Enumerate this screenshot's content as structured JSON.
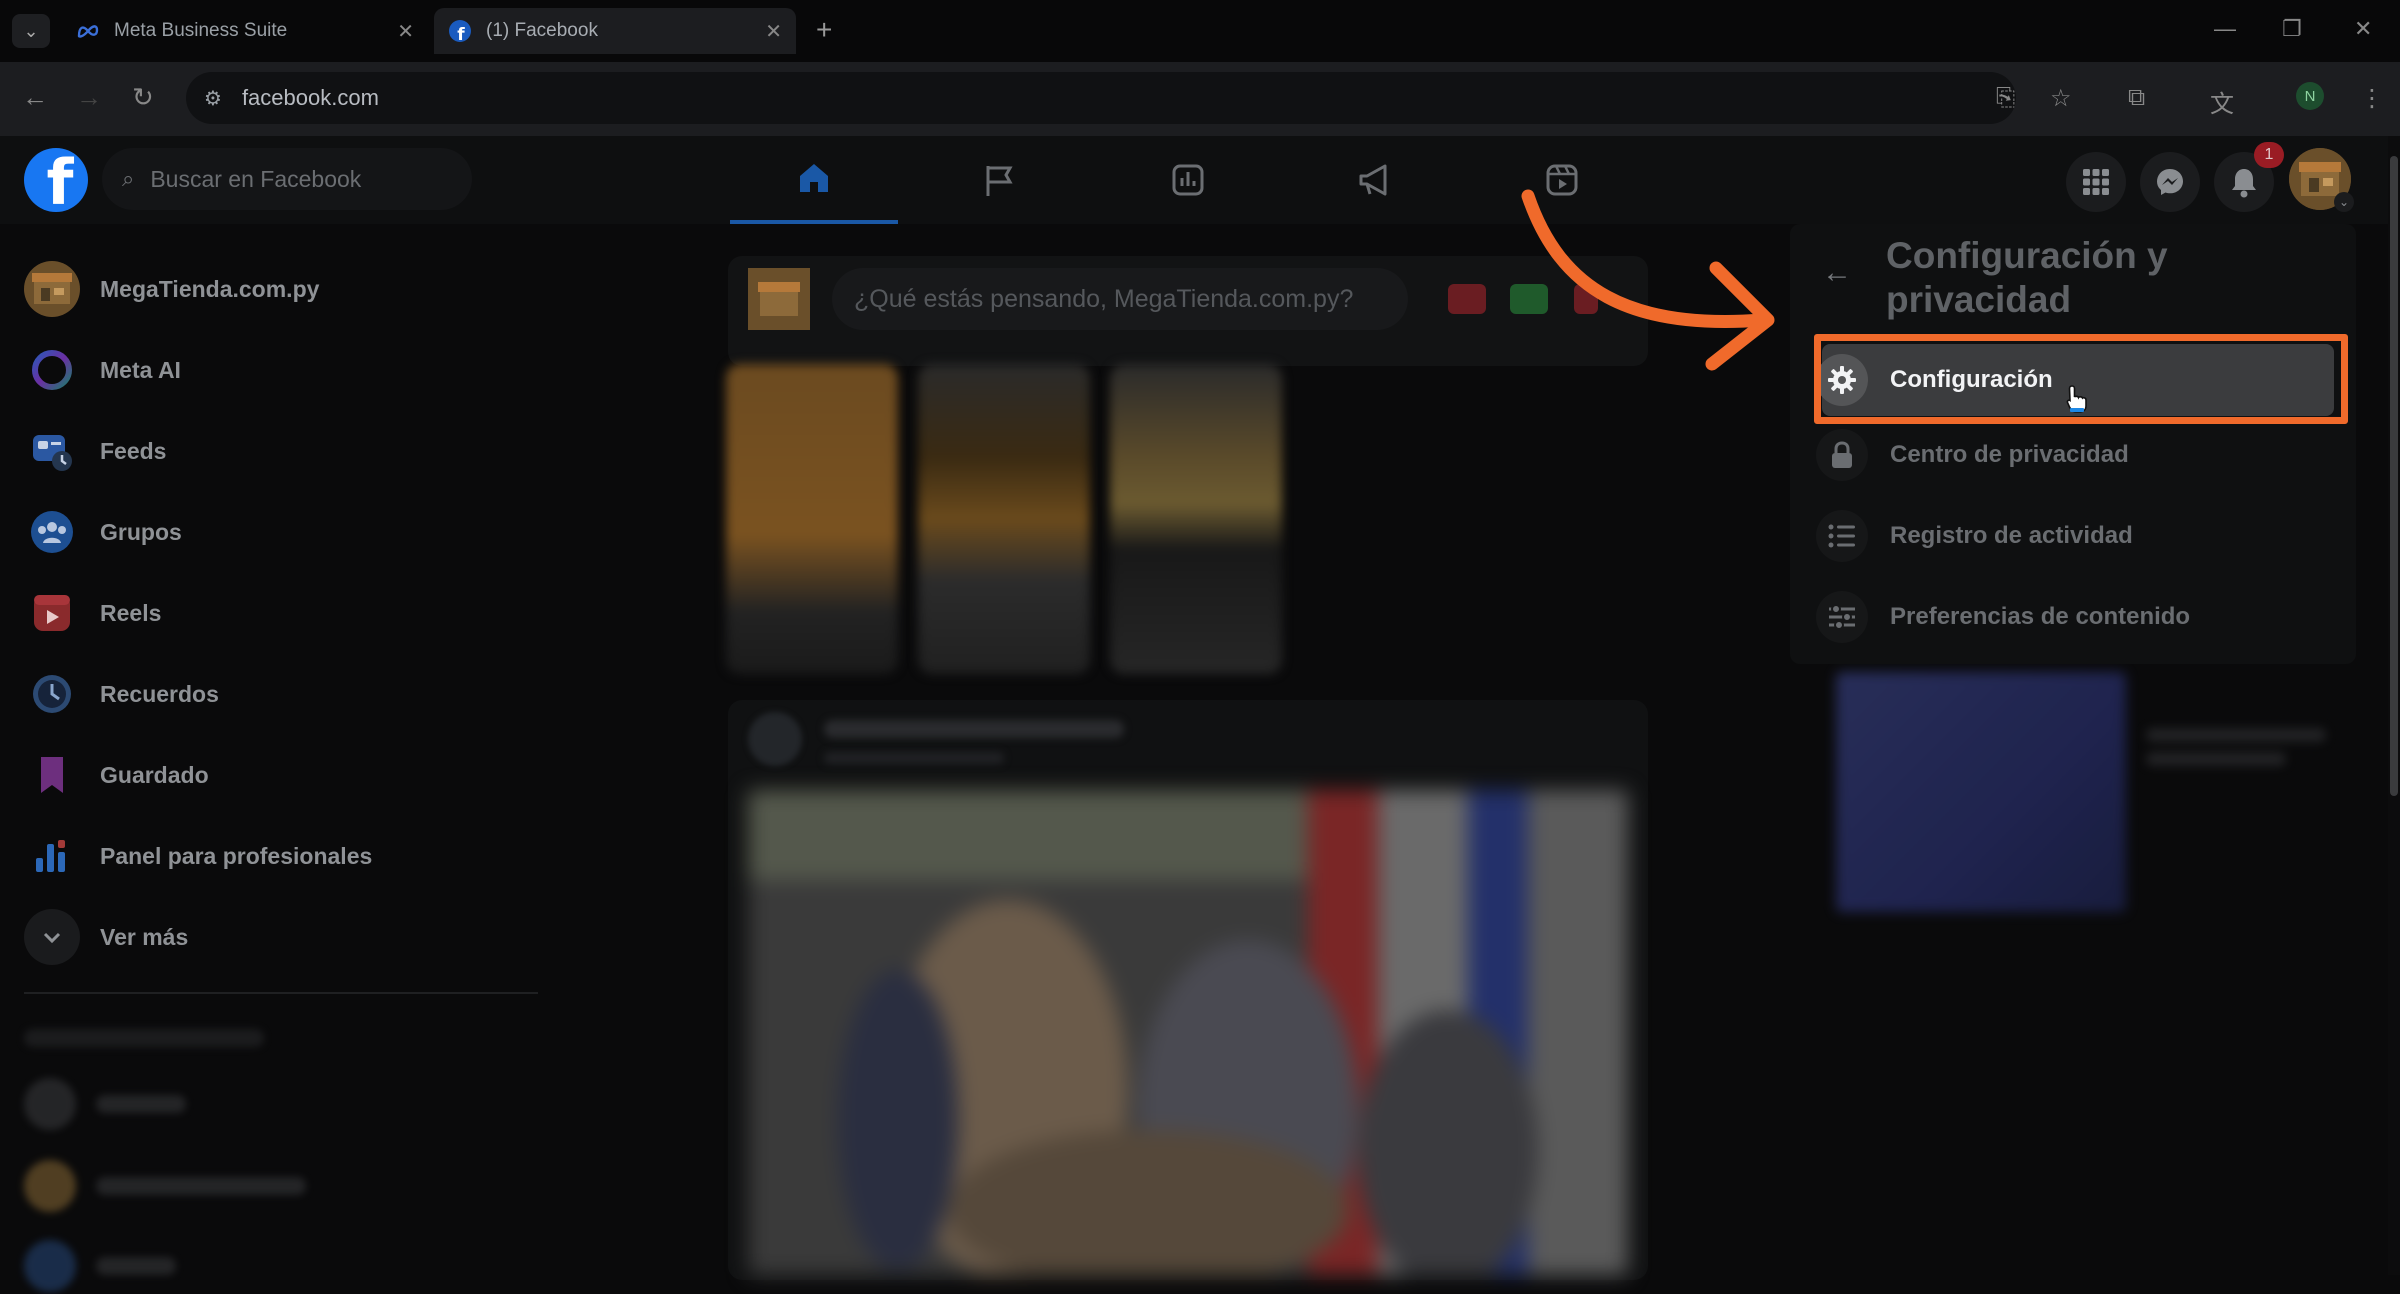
{
  "browser": {
    "tabs": [
      {
        "label": "Meta Business Suite",
        "icon": "meta-icon",
        "active": false
      },
      {
        "label": "(1) Facebook",
        "icon": "facebook-icon",
        "active": true
      }
    ],
    "url": "facebook.com",
    "profile_initial": "N"
  },
  "header": {
    "search_placeholder": "Buscar en Facebook",
    "notification_count": "1",
    "nav_tabs": [
      "home-icon",
      "flag-icon",
      "insights-icon",
      "megaphone-icon",
      "reels-icon"
    ]
  },
  "sidebar": {
    "items": [
      {
        "label": "MegaTienda.com.py",
        "icon": "page-avatar"
      },
      {
        "label": "Meta AI",
        "icon": "meta-ai-icon"
      },
      {
        "label": "Feeds",
        "icon": "feeds-icon"
      },
      {
        "label": "Grupos",
        "icon": "groups-icon"
      },
      {
        "label": "Reels",
        "icon": "reels-icon"
      },
      {
        "label": "Recuerdos",
        "icon": "memories-icon"
      },
      {
        "label": "Guardado",
        "icon": "saved-icon"
      },
      {
        "label": "Panel para profesionales",
        "icon": "dashboard-icon"
      },
      {
        "label": "Ver más",
        "icon": "chevron-down-icon"
      }
    ]
  },
  "composer": {
    "placeholder": "¿Qué estás pensando, MegaTienda.com.py?"
  },
  "dropdown": {
    "title": "Configuración y privacidad",
    "items": [
      {
        "label": "Configuración",
        "icon": "gear-icon",
        "highlighted": true
      },
      {
        "label": "Centro de privacidad",
        "icon": "lock-icon"
      },
      {
        "label": "Registro de actividad",
        "icon": "list-icon"
      },
      {
        "label": "Preferencias de contenido",
        "icon": "sliders-icon"
      }
    ]
  },
  "annotation": {
    "color": "#f06a2b"
  }
}
